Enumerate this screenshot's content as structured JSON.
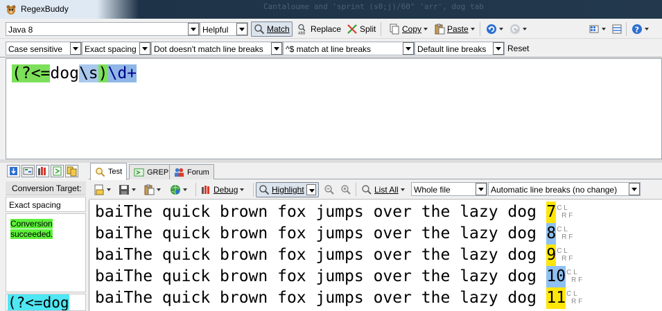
{
  "window": {
    "title": "RegexBuddy",
    "background_text": "Cantaloume   and 'sprint (s0;j)/60\" 'arr', dog tab"
  },
  "toolbar": {
    "flavor": "Java 8",
    "mode": "Helpful",
    "match_label": "Match",
    "replace_label": "Replace",
    "split_label": "Split",
    "copy_label": "Copy",
    "paste_label": "Paste"
  },
  "options": {
    "case": "Case sensitive",
    "spacing": "Exact spacing",
    "dot": "Dot doesn't match line breaks",
    "anchors": "^$ match at line breaks",
    "line_breaks": "Default line breaks",
    "reset_label": "Reset"
  },
  "regex": {
    "part1": "(?<=",
    "part2": "dog",
    "part3": "\\s",
    "part4": ")",
    "part5": "\\d+"
  },
  "left_panel": {
    "target_label": "Conversion Target:",
    "target_value": "Exact spacing",
    "result_line1": "Conversion",
    "result_line2": "succeeded.",
    "regex_preview": "(?<=dog"
  },
  "tabs": {
    "test": "Test",
    "grep": "GREP",
    "forum": "Forum"
  },
  "test_toolbar": {
    "debug_label": "Debug",
    "highlight_label": "Highlight",
    "list_all_label": "List All",
    "scope": "Whole file",
    "line_break_mode": "Automatic line breaks (no change)"
  },
  "test_lines": [
    {
      "text": "baiThe quick brown fox jumps over the lazy dog ",
      "match": "7",
      "color": "#ffe60a"
    },
    {
      "text": "baiThe quick brown fox jumps over the lazy dog ",
      "match": "8",
      "color": "#8fc0f2"
    },
    {
      "text": "baiThe quick brown fox jumps over the lazy dog ",
      "match": "9",
      "color": "#ffe60a"
    },
    {
      "text": "baiThe quick brown fox jumps over the lazy dog ",
      "match": "10",
      "color": "#8fc0f2"
    },
    {
      "text": "baiThe quick brown fox jumps over the lazy dog ",
      "match": "11",
      "color": "#ffe60a"
    }
  ],
  "line_marks": {
    "top": "C L",
    "bottom": "R F"
  },
  "colors": {
    "lookbehind": "#7ce05a",
    "token": "#a9c8ee",
    "match_odd": "#ffe60a",
    "match_even": "#8fc0f2",
    "success": "#5cf03a",
    "preview": "#4fe7f3"
  }
}
